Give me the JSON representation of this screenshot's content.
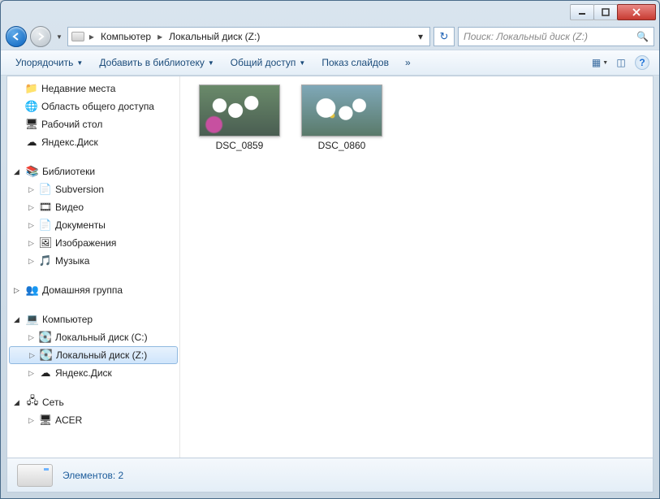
{
  "breadcrumb": {
    "seg1": "Компьютер",
    "seg2": "Локальный диск (Z:)"
  },
  "search": {
    "placeholder": "Поиск: Локальный диск (Z:)"
  },
  "toolbar": {
    "organize": "Упорядочить",
    "addlib": "Добавить в библиотеку",
    "share": "Общий доступ",
    "slideshow": "Показ слайдов",
    "more": "»"
  },
  "sidebar": {
    "favorites": [
      {
        "icon": "📁",
        "label": "Недавние места"
      },
      {
        "icon": "🌐",
        "label": "Область общего доступа"
      },
      {
        "icon": "🖥",
        "label": "Рабочий стол"
      },
      {
        "icon": "☁",
        "label": "Яндекс.Диск"
      }
    ],
    "libraries_label": "Библиотеки",
    "libraries": [
      {
        "icon": "📄",
        "label": "Subversion"
      },
      {
        "icon": "🎞",
        "label": "Видео"
      },
      {
        "icon": "📄",
        "label": "Документы"
      },
      {
        "icon": "🖼",
        "label": "Изображения"
      },
      {
        "icon": "🎵",
        "label": "Музыка"
      }
    ],
    "homegroup_label": "Домашняя группа",
    "computer_label": "Компьютер",
    "drives": [
      {
        "label": "Локальный диск (C:)"
      },
      {
        "label": "Локальный диск (Z:)"
      },
      {
        "label": "Яндекс.Диск"
      }
    ],
    "network_label": "Сеть",
    "network": [
      {
        "label": "ACER"
      }
    ]
  },
  "files": [
    {
      "name": "DSC_0859"
    },
    {
      "name": "DSC_0860"
    }
  ],
  "status": {
    "elements": "Элементов: 2"
  }
}
